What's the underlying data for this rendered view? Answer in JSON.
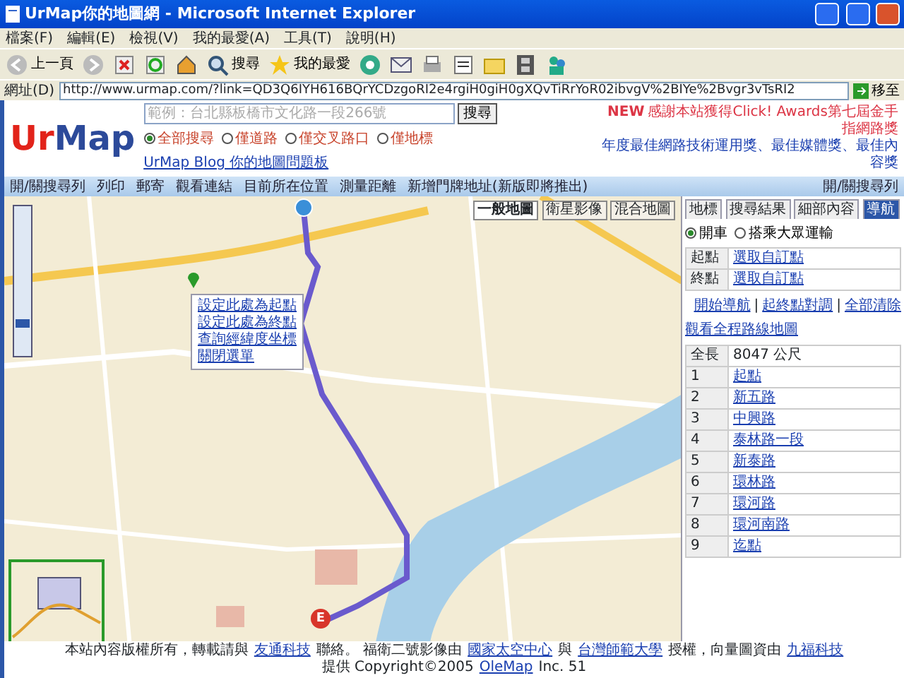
{
  "window": {
    "title": "UrMap你的地圖網 - Microsoft Internet Explorer"
  },
  "menu": [
    "檔案(F)",
    "編輯(E)",
    "檢視(V)",
    "我的最愛(A)",
    "工具(T)",
    "說明(H)"
  ],
  "toolbar": [
    {
      "kind": "back",
      "label": "上一頁"
    },
    {
      "kind": "forward"
    },
    {
      "kind": "stop"
    },
    {
      "kind": "refresh"
    },
    {
      "kind": "home"
    },
    {
      "kind": "search",
      "label": "搜尋"
    },
    {
      "kind": "favorites",
      "label": "我的最愛"
    },
    {
      "kind": "media"
    },
    {
      "kind": "mail"
    },
    {
      "kind": "print"
    },
    {
      "kind": "edit"
    },
    {
      "kind": "folder"
    },
    {
      "kind": "film"
    },
    {
      "kind": "people"
    }
  ],
  "address": {
    "label": "網址(D)",
    "url": "http://www.urmap.com/?link=QD3Q6IYH616BQrYCDzgoRI2e4rgiH0giH0gXQvTiRrYoR02ibvgV%2BIYe%2Bvgr3vTsRI2",
    "go": "移至"
  },
  "header": {
    "logo": [
      "Ur",
      "Map"
    ],
    "search_placeholder": "範例：台北縣板橋市文化路一段266號",
    "search_button": "搜尋",
    "filters": [
      {
        "label": "全部搜尋",
        "selected": true
      },
      {
        "label": "僅道路",
        "selected": false
      },
      {
        "label": "僅交叉路口",
        "selected": false
      },
      {
        "label": "僅地標",
        "selected": false
      }
    ],
    "blog_link": "UrMap Blog 你的地圖問題板",
    "award_badge": "NEW",
    "award_line1": "感謝本站獲得Click! Awards第七屆金手指網路獎",
    "award_line2": "年度最佳網路技術運用獎、最佳媒體獎、最佳內容獎"
  },
  "map_toolbar": {
    "items": [
      "開/關搜尋列",
      "列印",
      "郵寄",
      "觀看連結",
      "目前所在位置",
      "測量距離",
      "新增門牌地址(新版即將推出)"
    ],
    "right": "開/關搜尋列"
  },
  "map": {
    "view_buttons": [
      {
        "label": "一般地圖",
        "selected": true
      },
      {
        "label": "衛星影像",
        "selected": false
      },
      {
        "label": "混合地圖",
        "selected": false
      }
    ],
    "zoom_slider": {
      "level": 0.2
    },
    "context_menu": [
      "設定此處為起點",
      "設定此處為終點",
      "查詢經緯度坐標",
      "關閉選單"
    ],
    "end_marker": "E"
  },
  "panel": {
    "tabs": [
      {
        "label": "地標",
        "selected": false
      },
      {
        "label": "搜尋結果",
        "selected": false
      },
      {
        "label": "細部內容",
        "selected": false
      },
      {
        "label": "導航",
        "selected": true
      }
    ],
    "modes": [
      {
        "label": "開車",
        "selected": true
      },
      {
        "label": "搭乘大眾運輸",
        "selected": false
      }
    ],
    "start": {
      "label": "起點",
      "value": "選取自訂點"
    },
    "end": {
      "label": "終點",
      "value": "選取自訂點"
    },
    "actions": [
      "開始導航",
      "起終點對調",
      "全部清除"
    ],
    "action_separator": "|",
    "overview_link": "觀看全程路線地圖",
    "total": {
      "label": "全長",
      "value": "8047 公尺"
    },
    "steps": [
      {
        "num": "1",
        "name": "起點"
      },
      {
        "num": "2",
        "name": "新五路"
      },
      {
        "num": "3",
        "name": "中興路"
      },
      {
        "num": "4",
        "name": "泰林路一段"
      },
      {
        "num": "5",
        "name": "新泰路"
      },
      {
        "num": "6",
        "name": "環林路"
      },
      {
        "num": "7",
        "name": "環河路"
      },
      {
        "num": "8",
        "name": "環河南路"
      },
      {
        "num": "9",
        "name": "迄點"
      }
    ]
  },
  "footer": [
    {
      "text": "本站內容版權所有，轉載請與",
      "link": false
    },
    {
      "text": "友通科技",
      "link": true
    },
    {
      "text": "聯絡。 福衛二號影像由",
      "link": false
    },
    {
      "text": "國家太空中心",
      "link": true
    },
    {
      "text": "與",
      "link": false
    },
    {
      "text": "台灣師範大學",
      "link": true
    },
    {
      "text": "授權，向量圖資由",
      "link": false
    },
    {
      "text": "九福科技",
      "link": true
    },
    {
      "text": "提供 Copyright©2005",
      "link": false
    },
    {
      "text": "OleMap",
      "link": true
    },
    {
      "text": "Inc. 51",
      "link": false
    }
  ]
}
